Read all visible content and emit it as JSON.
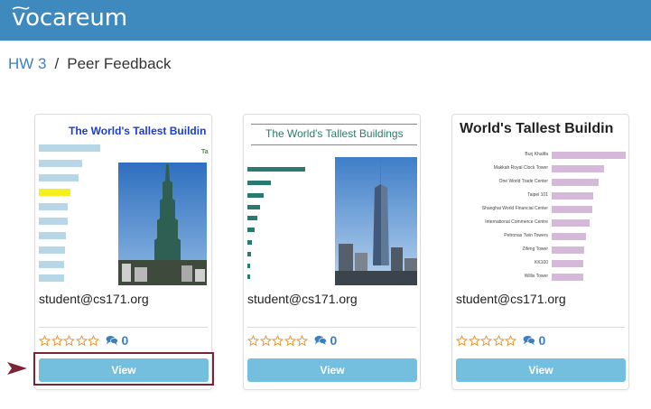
{
  "app": {
    "name": "vocareum"
  },
  "breadcrumb": {
    "parent": "HW 3",
    "separator": "/",
    "current": "Peer Feedback"
  },
  "submissions": [
    {
      "thumbnail_title": "The World's Tallest Buildin",
      "thumbnail_side_text": "Ta",
      "author": "student@cs171.org",
      "rating": 0,
      "rating_max": 5,
      "comment_count": "0",
      "button_label": "View"
    },
    {
      "thumbnail_title": "The World's Tallest Buildings",
      "author": "student@cs171.org",
      "rating": 0,
      "rating_max": 5,
      "comment_count": "0",
      "button_label": "View"
    },
    {
      "thumbnail_title": "World's Tallest Buildin",
      "thumbnail_labels": [
        "Burj Khalifa",
        "Makkah Royal Clock Tower",
        "One World Trade Center",
        "Taipei 101",
        "Shanghai World Financial Center",
        "International Commerce Centre",
        "Petronas Twin Towers",
        "Zifeng Tower",
        "KK100",
        "Willis Tower"
      ],
      "author": "student@cs171.org",
      "rating": 0,
      "rating_max": 5,
      "comment_count": "0",
      "button_label": "View"
    }
  ],
  "colors": {
    "header": "#3e89bd",
    "button": "#74bfde",
    "link": "#3a83c0",
    "star": "#e8962c",
    "highlight": "#7b2337"
  }
}
